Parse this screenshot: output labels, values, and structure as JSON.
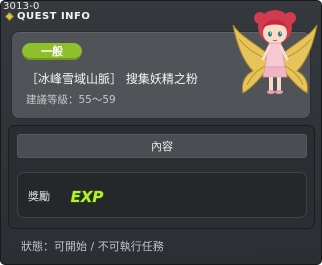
{
  "window": {
    "quest_id": "3013-0",
    "title": "QUEST INFO"
  },
  "quest": {
    "type_badge": "一般",
    "name": "［冰峰雪域山脈］ 搜集妖精之粉",
    "recommended_level": "建議等級：55～59"
  },
  "content": {
    "header": "內容",
    "reward_label": "獎勵",
    "reward_icon": "EXP"
  },
  "status": "狀態：可開始 / 不可執行任務",
  "colors": {
    "badge": "#8fbf2c",
    "exp_fill": "#b6f22c",
    "background": "#2f3337"
  },
  "icons": [
    "quest-info-icon",
    "npc-angel-portrait",
    "exp-icon"
  ]
}
